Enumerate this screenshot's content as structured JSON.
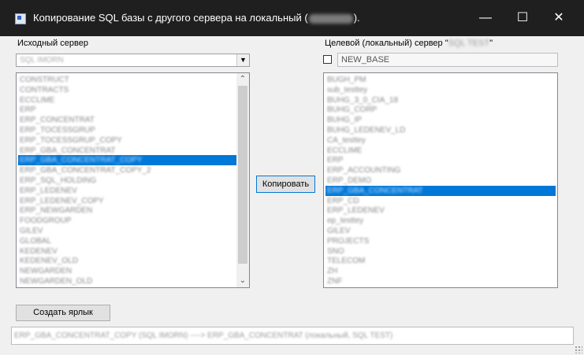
{
  "window": {
    "title": "Копирование SQL базы с другого сервера на локальный (",
    "title_end": ").",
    "minimize": "—",
    "maximize": "☐",
    "close": "✕"
  },
  "source": {
    "label": "Исходный сервер",
    "server_value": "SQL IMORN",
    "databases": [
      "CONSTRUCT",
      "CONTRACTS",
      "ECCLIME",
      "ERP",
      "ERP_CONCENTRAT",
      "ERP_TOCESSGRUP",
      "ERP_TOCESSGRUP_COPY",
      "ERP_GBA_CONCENTRAT",
      "ERP_GBA_CONCENTRAT_COPY",
      "ERP_GBA_CONCENTRAT_COPY_2",
      "ERP_SQL_HOLDING",
      "ERP_LEDENEV",
      "ERP_LEDENEV_COPY",
      "ERP_NEWGARDEN",
      "FOODGROUP",
      "GILEV",
      "GLOBAL",
      "KEDENEV",
      "KEDENEV_OLD",
      "NEWGARDEN",
      "NEWGARDEN_OLD"
    ],
    "selected_index": 8
  },
  "target": {
    "label_prefix": "Целевой (локальный) сервер \"",
    "server_name": "SQL TEST",
    "label_suffix": "\"",
    "new_base_checked": false,
    "new_base_value": "NEW_BASE",
    "databases": [
      "BUGH_PM",
      "sub_testtey",
      "BUHG_3_0_CIA_18",
      "BUHG_CORP",
      "BUHG_IP",
      "BUHG_LEDENEV_LD",
      "CA_testtey",
      "ECCLIME",
      "ERP",
      "ERP_ACCOUNTING",
      "ERP_DEMO",
      "ERP_GBA_CONCENTRAT",
      "ERP_CD",
      "ERP_LEDENEV",
      "ep_testtey",
      "GILEV",
      "PROJECTS",
      "SNO",
      "TELECOM",
      "ZH",
      "ZNF"
    ],
    "selected_index": 11
  },
  "actions": {
    "copy_label": "Копировать",
    "shortcut_label": "Создать ярлык"
  },
  "status": {
    "text": "ERP_GBA_CONCENTRAT_COPY (SQL IMORN) ----> ERP_GBA_CONCENTRAT (локальный, SQL TEST)"
  }
}
